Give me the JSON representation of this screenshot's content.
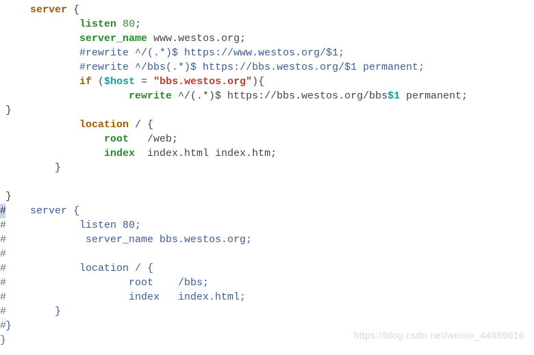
{
  "lines": [
    {
      "gutter": " ",
      "hl": false,
      "segments": [
        {
          "cls": "txt",
          "text": "    "
        },
        {
          "cls": "kw-brown",
          "text": "server"
        },
        {
          "cls": "txt",
          "text": " {"
        }
      ]
    },
    {
      "gutter": " ",
      "hl": false,
      "segments": [
        {
          "cls": "txt",
          "text": "            "
        },
        {
          "cls": "kw-green",
          "text": "listen"
        },
        {
          "cls": "txt",
          "text": " "
        },
        {
          "cls": "num-green",
          "text": "80"
        },
        {
          "cls": "txt",
          "text": ";"
        }
      ]
    },
    {
      "gutter": " ",
      "hl": false,
      "segments": [
        {
          "cls": "txt",
          "text": "            "
        },
        {
          "cls": "kw-green",
          "text": "server_name"
        },
        {
          "cls": "txt",
          "text": " www.westos.org;"
        }
      ]
    },
    {
      "gutter": " ",
      "hl": false,
      "segments": [
        {
          "cls": "txt",
          "text": "            "
        },
        {
          "cls": "comment",
          "text": "#rewrite ^/(.*)$ https://www.westos.org/$1;"
        }
      ]
    },
    {
      "gutter": " ",
      "hl": false,
      "segments": [
        {
          "cls": "txt",
          "text": "            "
        },
        {
          "cls": "comment",
          "text": "#rewrite ^/bbs(.*)$ https://bbs.westos.org/$1 permanent;"
        }
      ]
    },
    {
      "gutter": " ",
      "hl": false,
      "segments": [
        {
          "cls": "txt",
          "text": "            "
        },
        {
          "cls": "kw-brown",
          "text": "if"
        },
        {
          "cls": "txt",
          "text": " ("
        },
        {
          "cls": "kw-teal",
          "text": "$host"
        },
        {
          "cls": "txt",
          "text": " = "
        },
        {
          "cls": "red",
          "text": "\"bbs.westos.org\""
        },
        {
          "cls": "txt",
          "text": "){"
        }
      ]
    },
    {
      "gutter": " ",
      "hl": false,
      "segments": [
        {
          "cls": "txt",
          "text": "                    "
        },
        {
          "cls": "kw-green",
          "text": "rewrite"
        },
        {
          "cls": "txt",
          "text": " ^/(.*)$ https://bbs.westos.org/bbs"
        },
        {
          "cls": "teal",
          "text": "$1"
        },
        {
          "cls": "txt",
          "text": " permanent;"
        }
      ]
    },
    {
      "gutter": " ",
      "hl": false,
      "segments": [
        {
          "cls": "txt",
          "text": "}"
        }
      ]
    },
    {
      "gutter": " ",
      "hl": false,
      "segments": [
        {
          "cls": "txt",
          "text": "            "
        },
        {
          "cls": "kw-brown",
          "text": "location"
        },
        {
          "cls": "txt",
          "text": " / {"
        }
      ]
    },
    {
      "gutter": " ",
      "hl": false,
      "segments": [
        {
          "cls": "txt",
          "text": "                "
        },
        {
          "cls": "kw-green",
          "text": "root"
        },
        {
          "cls": "txt",
          "text": "   /web;"
        }
      ]
    },
    {
      "gutter": " ",
      "hl": false,
      "segments": [
        {
          "cls": "txt",
          "text": "                "
        },
        {
          "cls": "kw-green",
          "text": "index"
        },
        {
          "cls": "txt",
          "text": "  index.html index.htm;"
        }
      ]
    },
    {
      "gutter": " ",
      "hl": false,
      "segments": [
        {
          "cls": "txt",
          "text": "        }"
        }
      ]
    },
    {
      "gutter": " ",
      "hl": false,
      "segments": [
        {
          "cls": "txt",
          "text": ""
        }
      ]
    },
    {
      "gutter": " ",
      "hl": false,
      "segments": [
        {
          "cls": "txt",
          "text": "}"
        }
      ]
    },
    {
      "gutter": "#",
      "hl": true,
      "segments": [
        {
          "cls": "blue",
          "text": "    server {"
        }
      ]
    },
    {
      "gutter": "#",
      "hl": false,
      "segments": [
        {
          "cls": "blue",
          "text": "            listen 80;"
        }
      ]
    },
    {
      "gutter": "#",
      "hl": false,
      "segments": [
        {
          "cls": "blue",
          "text": "             server_name bbs.westos.org;"
        }
      ]
    },
    {
      "gutter": "#",
      "hl": false,
      "segments": [
        {
          "cls": "blue",
          "text": ""
        }
      ]
    },
    {
      "gutter": "#",
      "hl": false,
      "segments": [
        {
          "cls": "blue",
          "text": "            location / {"
        }
      ]
    },
    {
      "gutter": "#",
      "hl": false,
      "segments": [
        {
          "cls": "blue",
          "text": "                    root    /bbs;"
        }
      ]
    },
    {
      "gutter": "#",
      "hl": false,
      "segments": [
        {
          "cls": "blue",
          "text": "                    index   index.html;"
        }
      ]
    },
    {
      "gutter": "#",
      "hl": false,
      "segments": [
        {
          "cls": "blue",
          "text": "        }"
        }
      ]
    },
    {
      "gutter": "#",
      "hl": false,
      "segments": [
        {
          "cls": "blue",
          "text": "}"
        }
      ]
    },
    {
      "gutter": "}",
      "hl": false,
      "segments": [
        {
          "cls": "txt",
          "text": ""
        }
      ]
    }
  ],
  "watermark": "https://blog.csdn.net/weixin_44889616"
}
